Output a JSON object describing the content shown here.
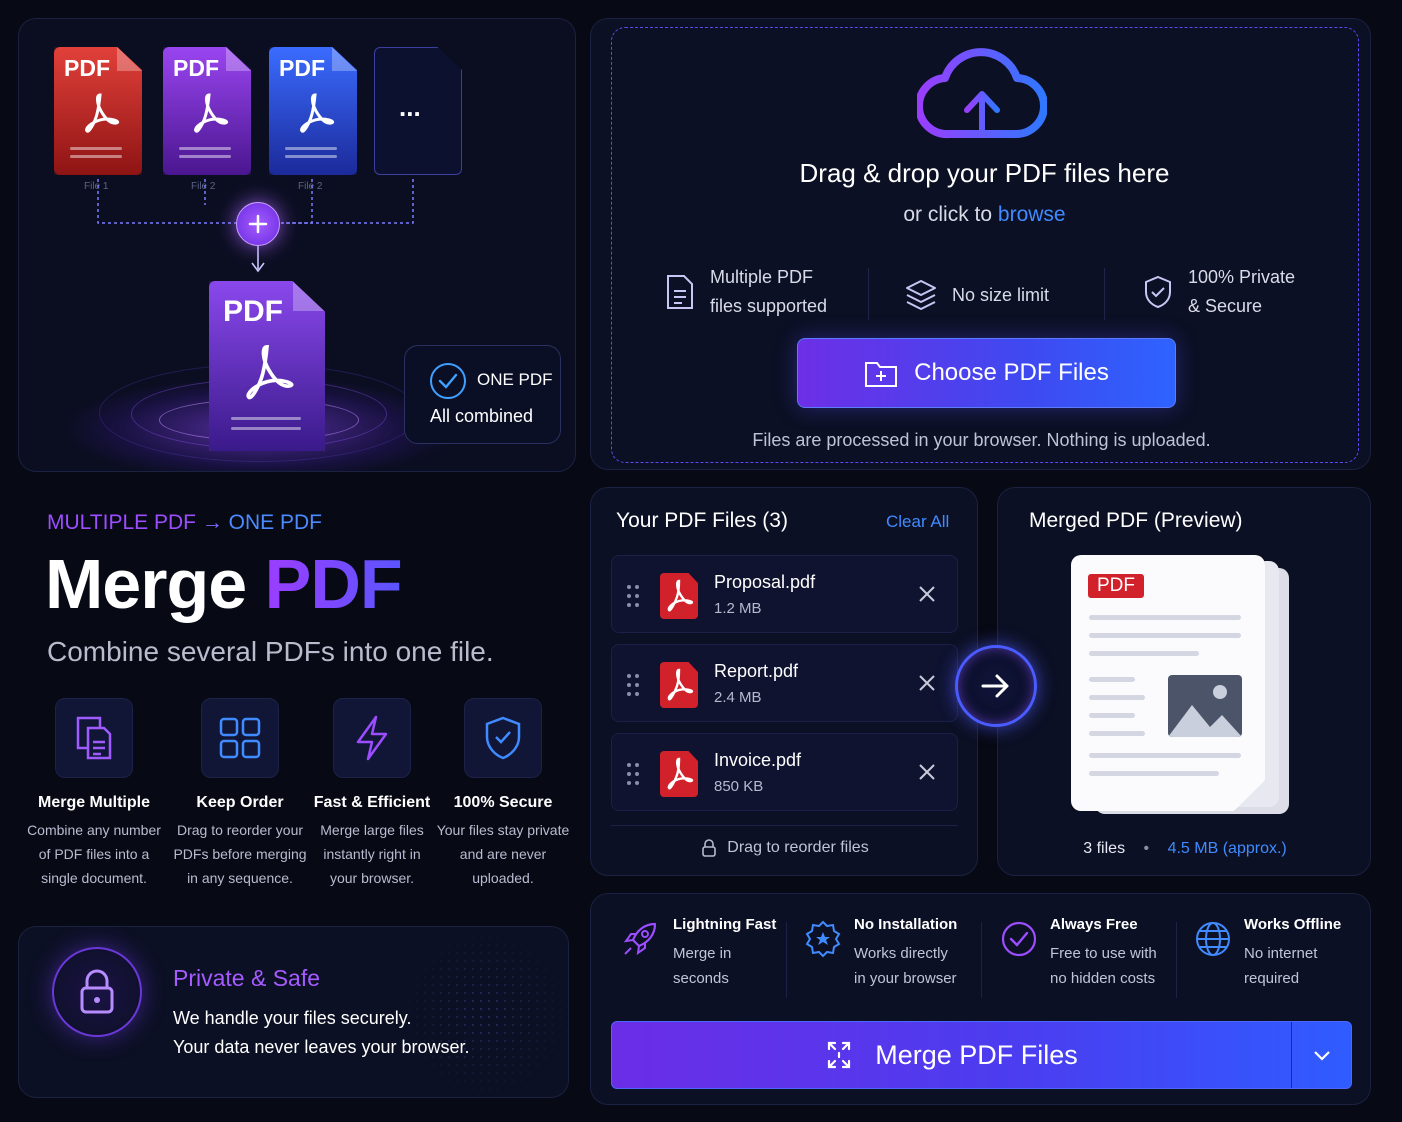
{
  "hero": {
    "files": [
      {
        "label": "PDF",
        "caption": "File 1"
      },
      {
        "label": "PDF",
        "caption": "File 2"
      },
      {
        "label": "PDF",
        "caption": "File 2"
      }
    ],
    "more": "...",
    "merged_label": "PDF",
    "badge_title": "ONE PDF",
    "badge_sub": "All combined"
  },
  "upload": {
    "title": "Drag & drop your PDF files here",
    "sub_prefix": "or click to",
    "browse": "browse",
    "features": [
      {
        "icon": "document-icon",
        "line1": "Multiple PDF",
        "line2": "files supported"
      },
      {
        "icon": "layers-icon",
        "line1": "No size limit",
        "line2": ""
      },
      {
        "icon": "shield-check-icon",
        "line1": "100% Private",
        "line2": "& Secure"
      }
    ],
    "choose_label": "Choose PDF Files",
    "note": "Files are processed in your browser. Nothing is uploaded."
  },
  "headline": {
    "kicker_a": "MULTIPLE PDF",
    "kicker_arrow": "→",
    "kicker_b": "ONE PDF",
    "title_a": "Merge",
    "title_b": "PDF",
    "subtitle": "Combine several PDFs into one file."
  },
  "features": [
    {
      "icon": "copy-icon",
      "title": "Merge Multiple",
      "desc": [
        "Combine any number",
        "of PDF files into a",
        "single document."
      ]
    },
    {
      "icon": "grid-icon",
      "title": "Keep Order",
      "desc": [
        "Drag to reorder your",
        "PDFs before merging",
        "in any sequence."
      ]
    },
    {
      "icon": "bolt-icon",
      "title": "Fast & Efficient",
      "desc": [
        "Merge large files",
        "instantly right in",
        "your browser."
      ]
    },
    {
      "icon": "shield-icon",
      "title": "100% Secure",
      "desc": [
        "Your files stay private",
        "and are never",
        "uploaded."
      ]
    }
  ],
  "private": {
    "title": "Private & Safe",
    "line1": "We handle your files securely.",
    "line2": "Your data never leaves your browser."
  },
  "files": {
    "title": "Your PDF Files (3)",
    "clear": "Clear All",
    "items": [
      {
        "name": "Proposal.pdf",
        "size": "1.2 MB"
      },
      {
        "name": "Report.pdf",
        "size": "2.4 MB"
      },
      {
        "name": "Invoice.pdf",
        "size": "850 KB"
      }
    ],
    "footer": "Drag to reorder files"
  },
  "preview": {
    "title": "Merged PDF (Preview)",
    "badge": "PDF",
    "count": "3 files",
    "dot": "•",
    "size": "4.5 MB (approx.)"
  },
  "bottom": {
    "features": [
      {
        "icon": "rocket-icon",
        "title": "Lightning Fast",
        "line1": "Merge in",
        "line2": "seconds"
      },
      {
        "icon": "star-badge-icon",
        "title": "No Installation",
        "line1": "Works directly",
        "line2": "in your browser"
      },
      {
        "icon": "check-circle-icon",
        "title": "Always Free",
        "line1": "Free to use with",
        "line2": "no hidden costs"
      },
      {
        "icon": "globe-icon",
        "title": "Works Offline",
        "line1": "No internet",
        "line2": "required"
      }
    ],
    "merge_label": "Merge PDF Files"
  },
  "colors": {
    "accent_purple": "#8b3dff",
    "accent_blue": "#3d7bff",
    "pdf_red": "#d1212b",
    "background": "#070914"
  }
}
